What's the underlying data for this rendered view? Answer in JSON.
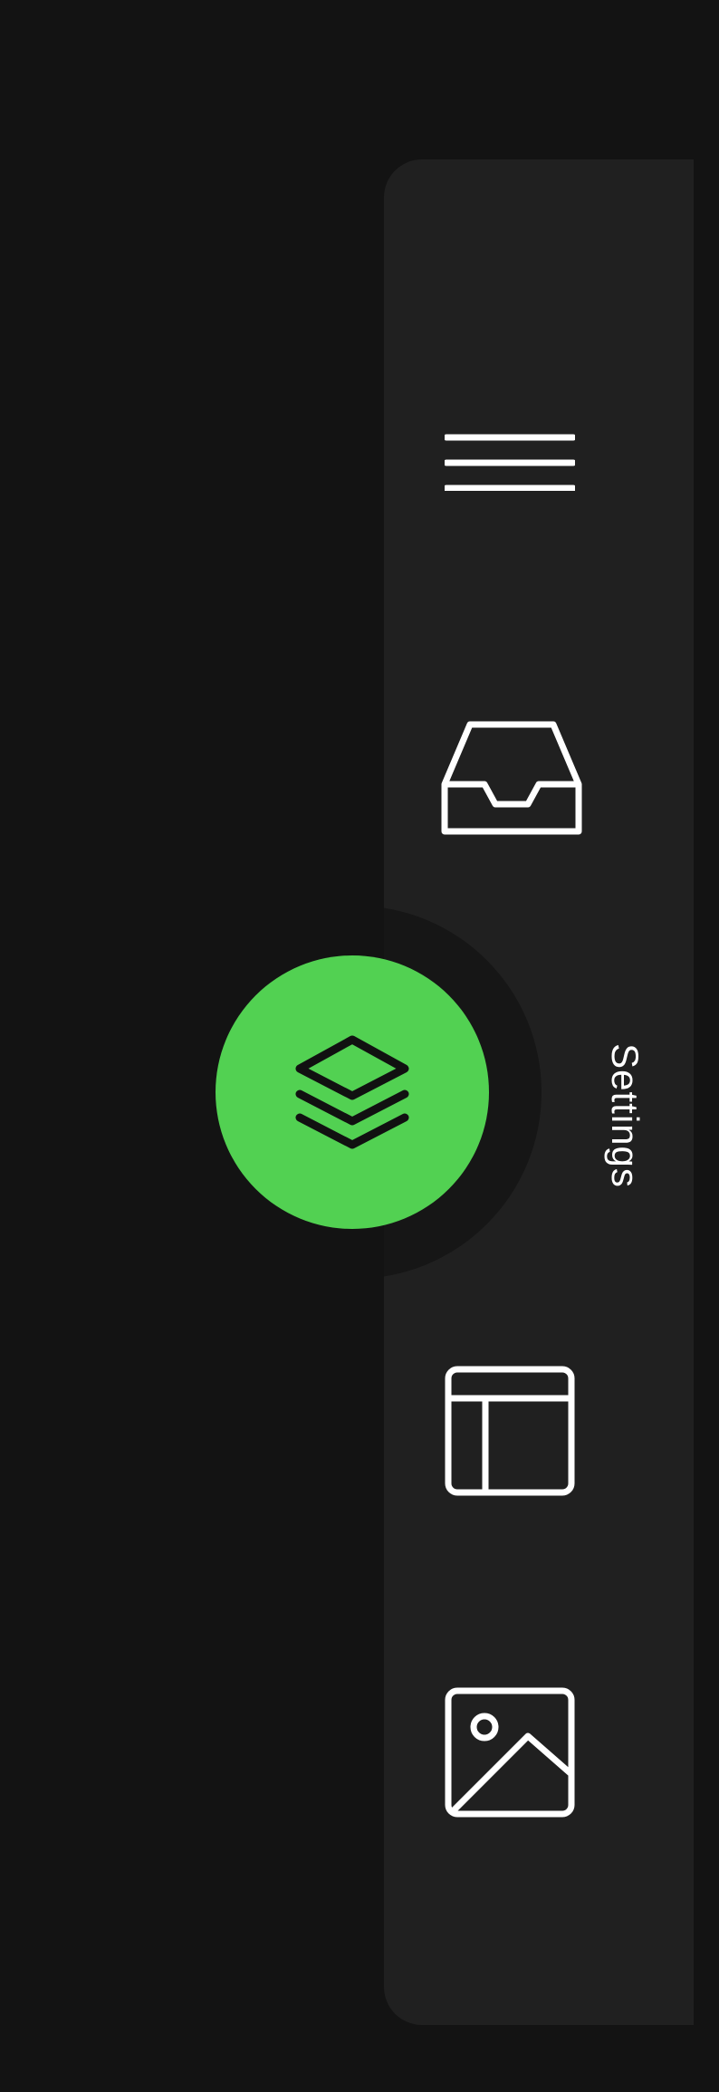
{
  "sidebar": {
    "background": "#202020",
    "items": [
      {
        "icon": "menu-icon"
      },
      {
        "icon": "inbox-icon"
      },
      {
        "icon": "layout-icon"
      },
      {
        "icon": "image-icon"
      }
    ],
    "label": "Settings"
  },
  "fab": {
    "icon": "layers-icon",
    "color": "#52d152"
  },
  "colors": {
    "page_background": "#131313",
    "icon_stroke": "#ffffff",
    "fab_icon": "#111111"
  }
}
